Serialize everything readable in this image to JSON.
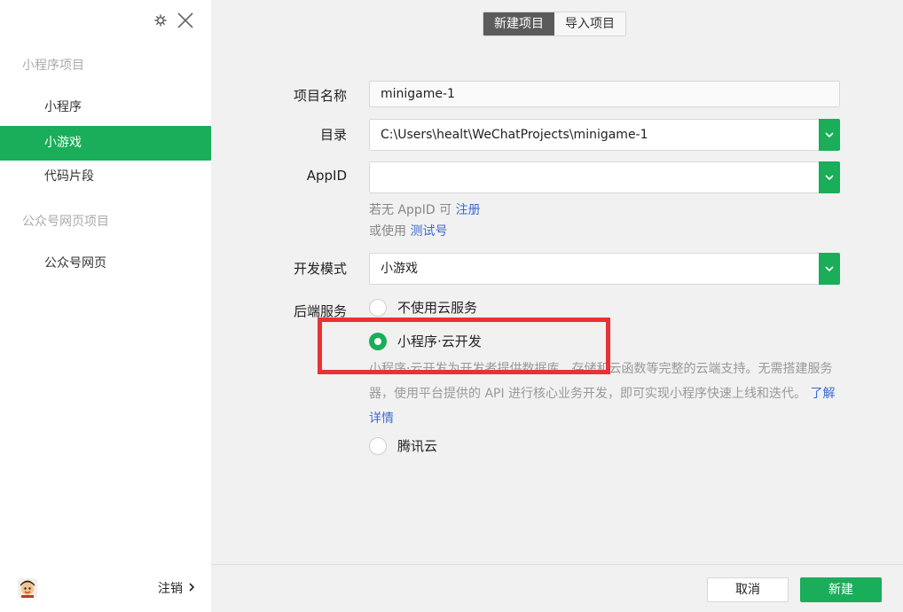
{
  "sidebar": {
    "top_icons": [
      "gear-icon",
      "close-icon"
    ],
    "groups": [
      {
        "title": "小程序项目",
        "items": [
          "小程序",
          "小游戏",
          "代码片段"
        ]
      },
      {
        "title": "公众号网页项目",
        "items": [
          "公众号网页"
        ]
      }
    ],
    "active_item": "小游戏",
    "logout_label": "注销"
  },
  "tabs": [
    {
      "label": "新建项目",
      "active": true
    },
    {
      "label": "导入项目",
      "active": false
    }
  ],
  "form": {
    "project_name_label": "项目名称",
    "project_name_value": "minigame-1",
    "directory_label": "目录",
    "directory_value": "C:\\Users\\healt\\WeChatProjects\\minigame-1",
    "appid_label": "AppID",
    "appid_value": "",
    "appid_hint_prefix": "若无 AppID 可 ",
    "appid_hint_link": "注册",
    "appid_hint2_prefix": "或使用 ",
    "appid_hint2_link": "测试号",
    "dev_mode_label": "开发模式",
    "dev_mode_value": "小游戏",
    "backend_label": "后端服务",
    "backend_options": [
      {
        "label": "不使用云服务",
        "checked": false
      },
      {
        "label": "小程序·云开发",
        "checked": true
      },
      {
        "label": "腾讯云",
        "checked": false
      }
    ],
    "cloud_desc": "小程序·云开发为开发者提供数据库、存储和云函数等完整的云端支持。无需搭建服务器，使用平台提供的 API 进行核心业务开发，即可实现小程序快速上线和迭代。",
    "cloud_desc_link": "了解详情"
  },
  "footer": {
    "cancel_label": "取消",
    "create_label": "新建"
  },
  "colors": {
    "accent": "#1aad5a",
    "highlight": "#e83234",
    "link": "#3d6bd0"
  }
}
